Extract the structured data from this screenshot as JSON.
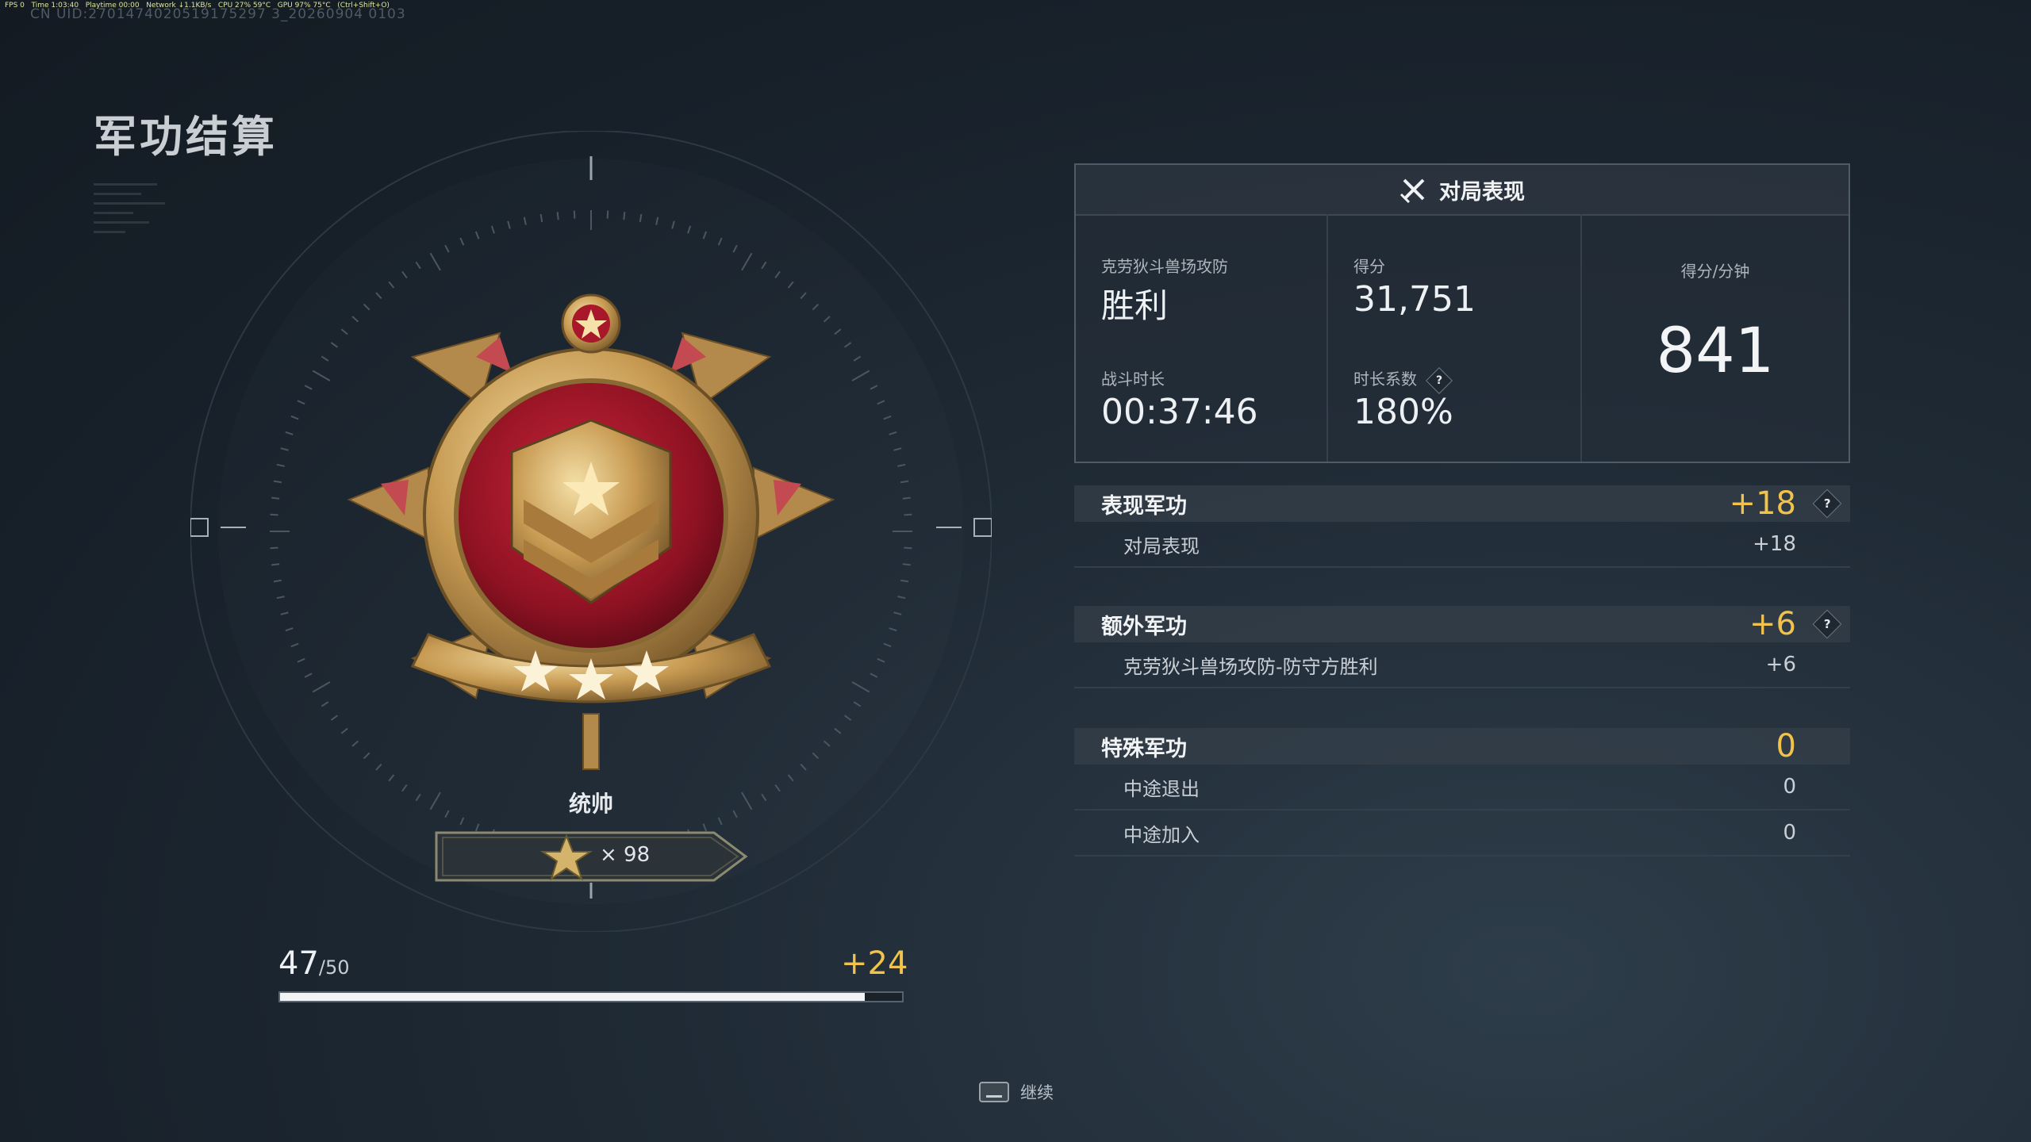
{
  "hud": {
    "fps": "FPS 0",
    "time": "Time 1:03:40",
    "playtime": "Playtime 00:00",
    "network": "Network ↓1.1KB/s",
    "cpu": "CPU 27% 59°C",
    "gpu": "GPU 97% 75°C",
    "shortcut": "(Ctrl+Shift+O)"
  },
  "uid": "CN UID:2701474020519175297 3_20260904 0103",
  "page_title": "军功结算",
  "rank": {
    "name": "统帅",
    "star_count": "× 98"
  },
  "progress": {
    "current": "47",
    "max": "/50",
    "gain": "+24",
    "fraction": 0.94
  },
  "performance": {
    "header": "对局表现",
    "mode_label": "克劳狄斗兽场攻防",
    "result": "胜利",
    "score_label": "得分",
    "score": "31,751",
    "spm_label": "得分/分钟",
    "spm": "841",
    "duration_label": "战斗时长",
    "duration": "00:37:46",
    "multiplier_label": "时长系数",
    "multiplier": "180%",
    "help_glyph": "?"
  },
  "sections": [
    {
      "name": "表现军功",
      "amount": "+18",
      "rows": [
        {
          "name": "对局表现",
          "amount": "+18"
        }
      ]
    },
    {
      "name": "额外军功",
      "amount": "+6",
      "rows": [
        {
          "name": "克劳狄斗兽场攻防-防守方胜利",
          "amount": "+6"
        }
      ]
    },
    {
      "name": "特殊军功",
      "amount": "0",
      "rows": [
        {
          "name": "中途退出",
          "amount": "0"
        },
        {
          "name": "中途加入",
          "amount": "0"
        }
      ]
    }
  ],
  "continue_label": "继续",
  "colors": {
    "accent_gold": "#f2c34a",
    "medal_red": "#a8182a",
    "medal_gold": "#d8b46a",
    "background": "#1f2a35"
  }
}
